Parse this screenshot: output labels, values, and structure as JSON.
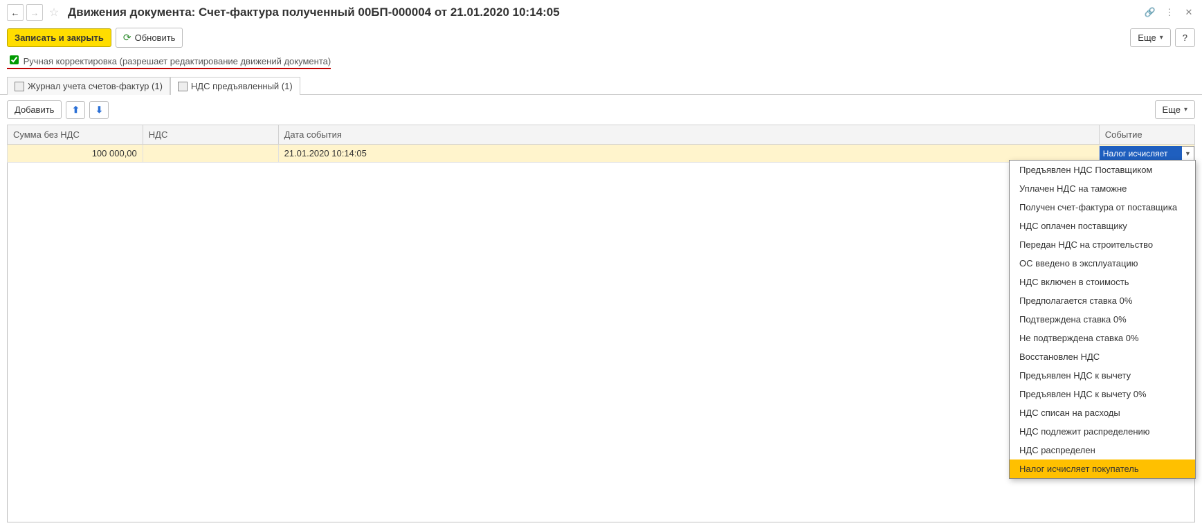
{
  "header": {
    "title": "Движения документа: Счет-фактура полученный 00БП-000004 от 21.01.2020 10:14:05"
  },
  "toolbar": {
    "save_close": "Записать и закрыть",
    "refresh": "Обновить",
    "more": "Еще",
    "help": "?"
  },
  "checkbox": {
    "label": "Ручная корректировка (разрешает редактирование движений документа)",
    "checked": true
  },
  "tabs": [
    {
      "label": "Журнал учета счетов-фактур (1)"
    },
    {
      "label": "НДС предъявленный (1)"
    }
  ],
  "subtoolbar": {
    "add": "Добавить",
    "more": "Еще"
  },
  "grid": {
    "headers": {
      "sum": "Сумма без НДС",
      "nds": "НДС",
      "date": "Дата события",
      "event": "Событие"
    },
    "rows": [
      {
        "sum": "100 000,00",
        "nds": "",
        "date": "21.01.2020 10:14:05",
        "event": "Налог исчисляет"
      }
    ]
  },
  "dropdown": {
    "items": [
      "Предъявлен НДС Поставщиком",
      "Уплачен НДС на таможне",
      "Получен счет-фактура от поставщика",
      "НДС оплачен поставщику",
      "Передан НДС на строительство",
      "ОС введено в эксплуатацию",
      "НДС включен в стоимость",
      "Предполагается ставка 0%",
      "Подтверждена ставка 0%",
      "Не подтверждена ставка 0%",
      "Восстановлен НДС",
      "Предъявлен НДС к вычету",
      "Предъявлен НДС к вычету 0%",
      "НДС списан на расходы",
      "НДС подлежит распределению",
      "НДС распределен",
      "Налог исчисляет покупатель"
    ],
    "selected_index": 16
  }
}
